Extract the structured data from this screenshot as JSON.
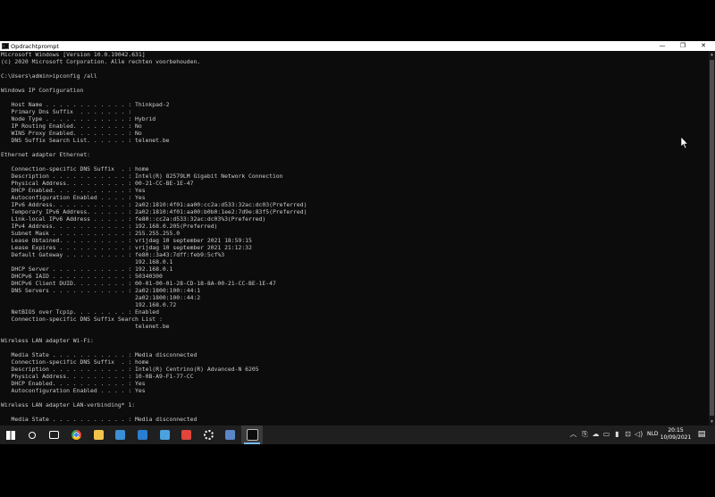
{
  "window": {
    "title": "Opdrachtprompt",
    "minimize_glyph": "—",
    "maximize_glyph": "❐",
    "close_glyph": "✕"
  },
  "terminal": {
    "lines": [
      "Microsoft Windows [Version 10.0.19042.631]",
      "(c) 2020 Microsoft Corporation. Alle rechten voorbehouden.",
      "",
      "C:\\Users\\admin>ipconfig /all",
      "",
      "Windows IP Configuration",
      "",
      "   Host Name . . . . . . . . . . . . : Thinkpad-2",
      "   Primary Dns Suffix  . . . . . . . :",
      "   Node Type . . . . . . . . . . . . : Hybrid",
      "   IP Routing Enabled. . . . . . . . : No",
      "   WINS Proxy Enabled. . . . . . . . : No",
      "   DNS Suffix Search List. . . . . . : telenet.be",
      "",
      "Ethernet adapter Ethernet:",
      "",
      "   Connection-specific DNS Suffix  . : home",
      "   Description . . . . . . . . . . . : Intel(R) 82579LM Gigabit Network Connection",
      "   Physical Address. . . . . . . . . : 00-21-CC-BE-1E-47",
      "   DHCP Enabled. . . . . . . . . . . : Yes",
      "   Autoconfiguration Enabled . . . . : Yes",
      "   IPv6 Address. . . . . . . . . . . : 2a02:1810:4f01:aa00:cc2a:d533:32ac:dc03(Preferred)",
      "   Temporary IPv6 Address. . . . . . : 2a02:1810:4f01:aa00:b0b0:1ee2:7d9e:83f5(Preferred)",
      "   Link-local IPv6 Address . . . . . : fe80::cc2a:d533:32ac:dc03%3(Preferred)",
      "   IPv4 Address. . . . . . . . . . . : 192.168.0.205(Preferred)",
      "   Subnet Mask . . . . . . . . . . . : 255.255.255.0",
      "   Lease Obtained. . . . . . . . . . : vrijdag 10 september 2021 18:59:15",
      "   Lease Expires . . . . . . . . . . : vrijdag 10 september 2021 21:12:32",
      "   Default Gateway . . . . . . . . . : fe80::3a43:7dff:feb9:5cf%3",
      "                                       192.168.0.1",
      "   DHCP Server . . . . . . . . . . . : 192.168.0.1",
      "   DHCPv6 IAID . . . . . . . . . . . : 50340300",
      "   DHCPv6 Client DUID. . . . . . . . : 00-01-00-01-28-CD-18-8A-00-21-CC-BE-1E-47",
      "   DNS Servers . . . . . . . . . . . : 2a02:1800:100::44:1",
      "                                       2a02:1800:100::44:2",
      "                                       192.168.0.72",
      "   NetBIOS over Tcpip. . . . . . . . : Enabled",
      "   Connection-specific DNS Suffix Search List :",
      "                                       telenet.be",
      "",
      "Wireless LAN adapter Wi-Fi:",
      "",
      "   Media State . . . . . . . . . . . : Media disconnected",
      "   Connection-specific DNS Suffix  . : home",
      "   Description . . . . . . . . . . . : Intel(R) Centrino(R) Advanced-N 6205",
      "   Physical Address. . . . . . . . . : 10-0B-A9-F1-77-CC",
      "   DHCP Enabled. . . . . . . . . . . : Yes",
      "   Autoconfiguration Enabled . . . . : Yes",
      "",
      "Wireless LAN adapter LAN-verbinding* 1:",
      "",
      "   Media State . . . . . . . . . . . : Media disconnected"
    ]
  },
  "taskbar": {
    "apps": [
      {
        "icon": "windows-start-icon",
        "color": "#ffffff"
      },
      {
        "icon": "search-icon",
        "color": "#ffffff"
      },
      {
        "icon": "task-view-icon",
        "color": "#ffffff"
      },
      {
        "icon": "chrome-icon",
        "color": "#e8453c"
      },
      {
        "icon": "file-explorer-icon",
        "color": "#f3c44a"
      },
      {
        "icon": "store-icon",
        "color": "#3a8fd6"
      },
      {
        "icon": "mail-icon",
        "color": "#2a7dd1"
      },
      {
        "icon": "remote-desktop-icon",
        "color": "#4aa3df"
      },
      {
        "icon": "anydesk-icon",
        "color": "#e2453b"
      },
      {
        "icon": "settings-gear-icon",
        "color": "#ffffff"
      },
      {
        "icon": "network-tool-icon",
        "color": "#5a86c8"
      },
      {
        "icon": "command-prompt-icon",
        "color": "#0c0c0c"
      }
    ],
    "language": "NLD",
    "time": "20:15",
    "date": "10/09/2021"
  }
}
